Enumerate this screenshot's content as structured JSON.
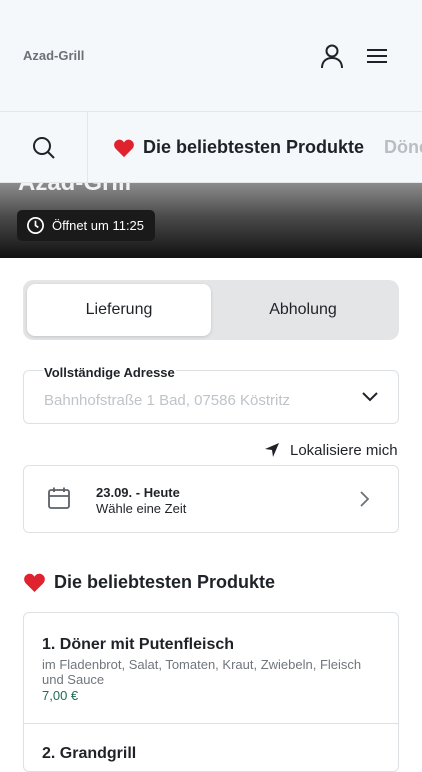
{
  "header": {
    "brand": "Azad-Grill"
  },
  "category_bar": {
    "active_tab": "Die beliebtesten Produkte",
    "next_tab": "Döner"
  },
  "hero": {
    "title": "Azad-Grill",
    "open_status": "Öffnet um 11:25"
  },
  "delivery_mode": {
    "options": [
      "Lieferung",
      "Abholung"
    ],
    "selected": "Lieferung"
  },
  "address": {
    "label": "Vollständige Adresse",
    "placeholder": "Bahnhofstraße 1 Bad, 07586 Köstritz"
  },
  "locate": {
    "label": "Lokalisiere mich"
  },
  "time": {
    "date": "23.09. - Heute",
    "hint": "Wähle eine Zeit"
  },
  "section": {
    "title": "Die beliebtesten Produkte"
  },
  "products": [
    {
      "name": "1. Döner mit Putenfleisch",
      "description": "im Fladenbrot, Salat, Tomaten, Kraut, Zwiebeln, Fleisch und Sauce",
      "price": "7,00 €"
    },
    {
      "name": "2. Grandgrill"
    }
  ],
  "colors": {
    "heart": "#e0222f",
    "price": "#1e6e4f",
    "background": "#f5f8fa"
  },
  "icons": [
    "user-icon",
    "menu-icon",
    "search-icon",
    "heart-icon",
    "clock-icon",
    "chevron-down-icon",
    "navigation-arrow-icon",
    "calendar-icon",
    "chevron-right-icon"
  ]
}
